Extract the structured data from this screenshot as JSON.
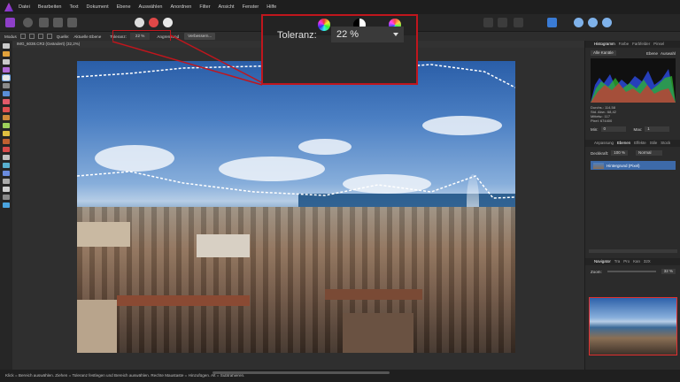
{
  "menubar": {
    "items": [
      "Datei",
      "Bearbeiten",
      "Text",
      "Dokument",
      "Ebene",
      "Auswählen",
      "Anordnen",
      "Filter",
      "Ansicht",
      "Fenster",
      "Hilfe"
    ]
  },
  "contextbar": {
    "mode_label": "Modus",
    "source_label": "Quelle:",
    "source_value": "Aktuelle Ebene",
    "tolerance_label": "Toleranz:",
    "tolerance_value": "22 %",
    "contiguous_label": "Angrenzend",
    "refine_label": "Verbessern..."
  },
  "document": {
    "tab_title": "IMG_6038.CR3 (Geändert) (32,2%)"
  },
  "zoom_callout": {
    "label": "Toleranz:",
    "value": "22 %"
  },
  "panels": {
    "top_tabs": [
      "Histogramm",
      "Farbe",
      "Farbfelder",
      "Pinsel"
    ],
    "channels": "Alle Kanäle",
    "layer_toggle": "Ebene",
    "selection_toggle": "Auswahl",
    "stats": [
      "Durchs.: 114,58",
      "Std. Abw.: 68,42",
      "Mittelw.: 117",
      "Pixel: 674400"
    ],
    "min_label": "Min:",
    "min_value": "0",
    "max_label": "Max:",
    "max_value": "1",
    "layer_tabs": [
      "Anpassung",
      "Ebenen",
      "Effekte",
      "Stile",
      "Stock"
    ],
    "opacity_label": "Deckkraft:",
    "opacity_value": "100 %",
    "blend_mode": "Normal",
    "layer_name": "Hintergrund (Pixel)",
    "nav_tabs": [
      "Navigator",
      "Tra",
      "Pro",
      "Kan",
      "32X"
    ],
    "zoom_label": "Zoom:",
    "zoom_value": "32 %"
  },
  "status": {
    "text": "Klick = Bereich auswählen. Ziehen = Toleranz festlegen und Bereich auswählen. Rechte Maustaste = Hinzufügen. Alt = Subtrahieren."
  },
  "colors": {
    "accent_red": "#c0161d",
    "layer_selected": "#3d6aa9"
  }
}
